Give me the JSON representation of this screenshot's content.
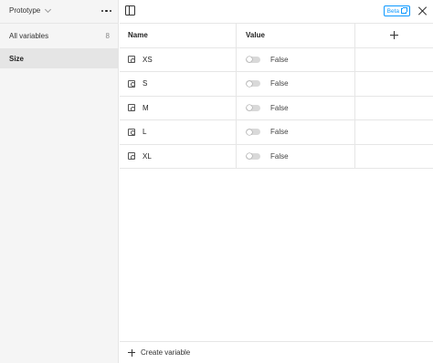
{
  "sidebar": {
    "collection_name": "Prototype",
    "items": [
      {
        "label": "All variables",
        "count": "8"
      },
      {
        "label": "Size",
        "count": ""
      }
    ]
  },
  "topbar": {
    "beta_label": "Beta"
  },
  "table": {
    "headers": {
      "name": "Name",
      "value": "Value"
    },
    "rows": [
      {
        "name": "XS",
        "value": "False"
      },
      {
        "name": "S",
        "value": "False"
      },
      {
        "name": "M",
        "value": "False"
      },
      {
        "name": "L",
        "value": "False"
      },
      {
        "name": "XL",
        "value": "False"
      }
    ]
  },
  "footer": {
    "create_label": "Create variable"
  },
  "icons": {
    "collection_dropdown": "chevron-down-icon",
    "more": "more-icon",
    "panel_toggle": "sidebar-toggle-icon",
    "external": "external-link-icon",
    "close": "close-icon",
    "add_column": "plus-icon",
    "variable": "boolean-variable-icon",
    "toggle": "toggle-icon"
  },
  "colors": {
    "accent": "#0d99ff",
    "sidebar_bg": "#f5f5f5",
    "selected_bg": "#e5e5e5",
    "border": "#e6e6e6"
  }
}
